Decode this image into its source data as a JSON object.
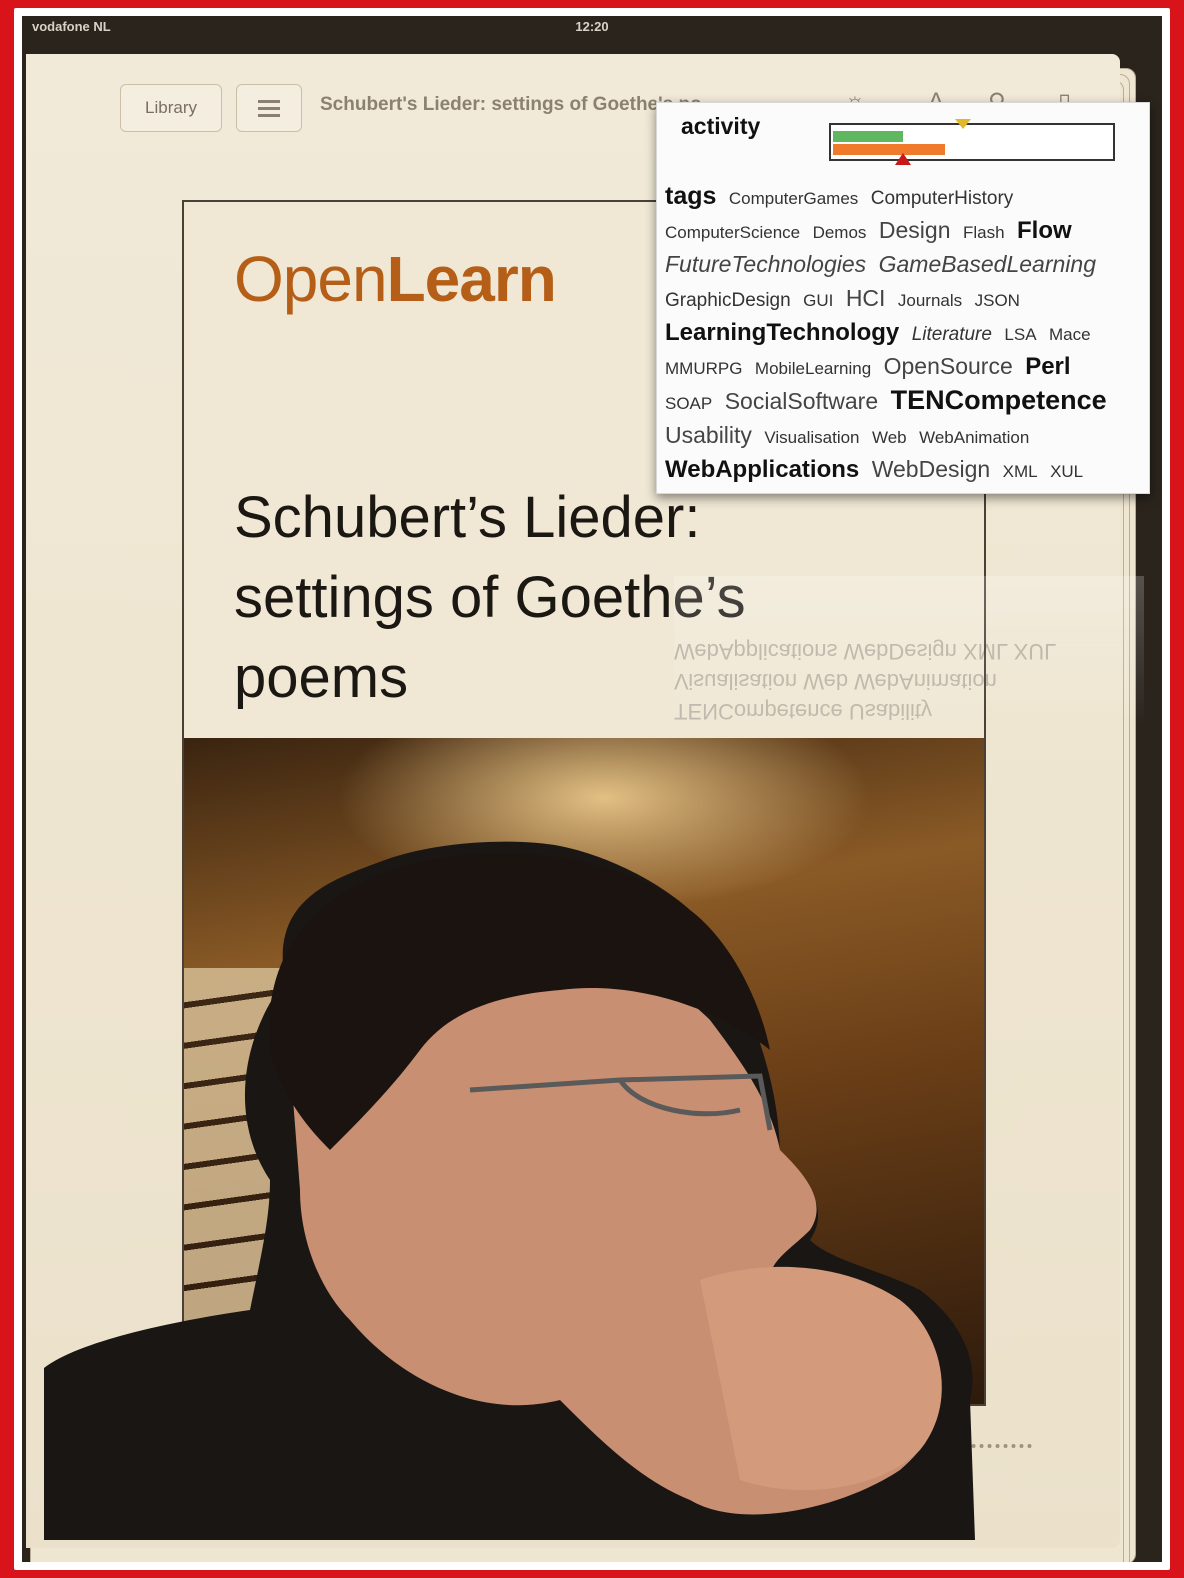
{
  "status": {
    "carrier": "vodafone NL",
    "time": "12:20"
  },
  "toolbar": {
    "library_label": "Library",
    "book_title": "Schubert's Lieder: settings of Goethe's poems"
  },
  "icons": [
    "signal-icon",
    "wifi-icon",
    "list-icon",
    "brightness-icon",
    "font-size-icon",
    "search-icon",
    "bookmark-icon"
  ],
  "cover": {
    "logo_open": "Open",
    "logo_learn": "Learn",
    "title": "Schubert’s Lieder: settings of Goethe’s poems",
    "brand_color": "#b45e18"
  },
  "overlay": {
    "activity_label": "activity",
    "activity_green": 0.25,
    "activity_orange": 0.4,
    "tags_label": "tags",
    "tags": [
      {
        "t": "ComputerGames",
        "w": 1
      },
      {
        "t": "ComputerHistory",
        "w": 2
      },
      {
        "t": "ComputerScience",
        "w": 1
      },
      {
        "t": "Demos",
        "w": 1
      },
      {
        "t": "Design",
        "w": 3
      },
      {
        "t": "Flash",
        "w": 1
      },
      {
        "t": "Flow",
        "w": 4
      },
      {
        "t": "FutureTechnologies",
        "w": 3,
        "i": true
      },
      {
        "t": "GameBasedLearning",
        "w": 3,
        "i": true
      },
      {
        "t": "GraphicDesign",
        "w": 2
      },
      {
        "t": "GUI",
        "w": 1
      },
      {
        "t": "HCI",
        "w": 3
      },
      {
        "t": "Journals",
        "w": 1
      },
      {
        "t": "JSON",
        "w": 1
      },
      {
        "t": "LearningTechnology",
        "w": 4
      },
      {
        "t": "Literature",
        "w": 2,
        "i": true
      },
      {
        "t": "LSA",
        "w": 1
      },
      {
        "t": "Mace",
        "w": 1
      },
      {
        "t": "MMURPG",
        "w": 1
      },
      {
        "t": "MobileLearning",
        "w": 1
      },
      {
        "t": "OpenSource",
        "w": 3
      },
      {
        "t": "Perl",
        "w": 4
      },
      {
        "t": "SOAP",
        "w": 1
      },
      {
        "t": "SocialSoftware",
        "w": 3
      },
      {
        "t": "TENCompetence",
        "w": 5
      },
      {
        "t": "Usability",
        "w": 3
      },
      {
        "t": "Visualisation",
        "w": 1
      },
      {
        "t": "Web",
        "w": 1
      },
      {
        "t": "WebAnimation",
        "w": 1
      },
      {
        "t": "WebApplications",
        "w": 4
      },
      {
        "t": "WebDesign",
        "w": 3
      },
      {
        "t": "XML",
        "w": 1
      },
      {
        "t": "XUL",
        "w": 1
      }
    ],
    "reflection_lines": [
      "WebApplications WebDesign XML XUL",
      "Visualisation Web WebAnimation",
      "TENCompetence Usability"
    ]
  },
  "colors": {
    "frame_red": "#d8141a",
    "meter_green": "#5fb85f",
    "meter_orange": "#ef7a2b"
  }
}
